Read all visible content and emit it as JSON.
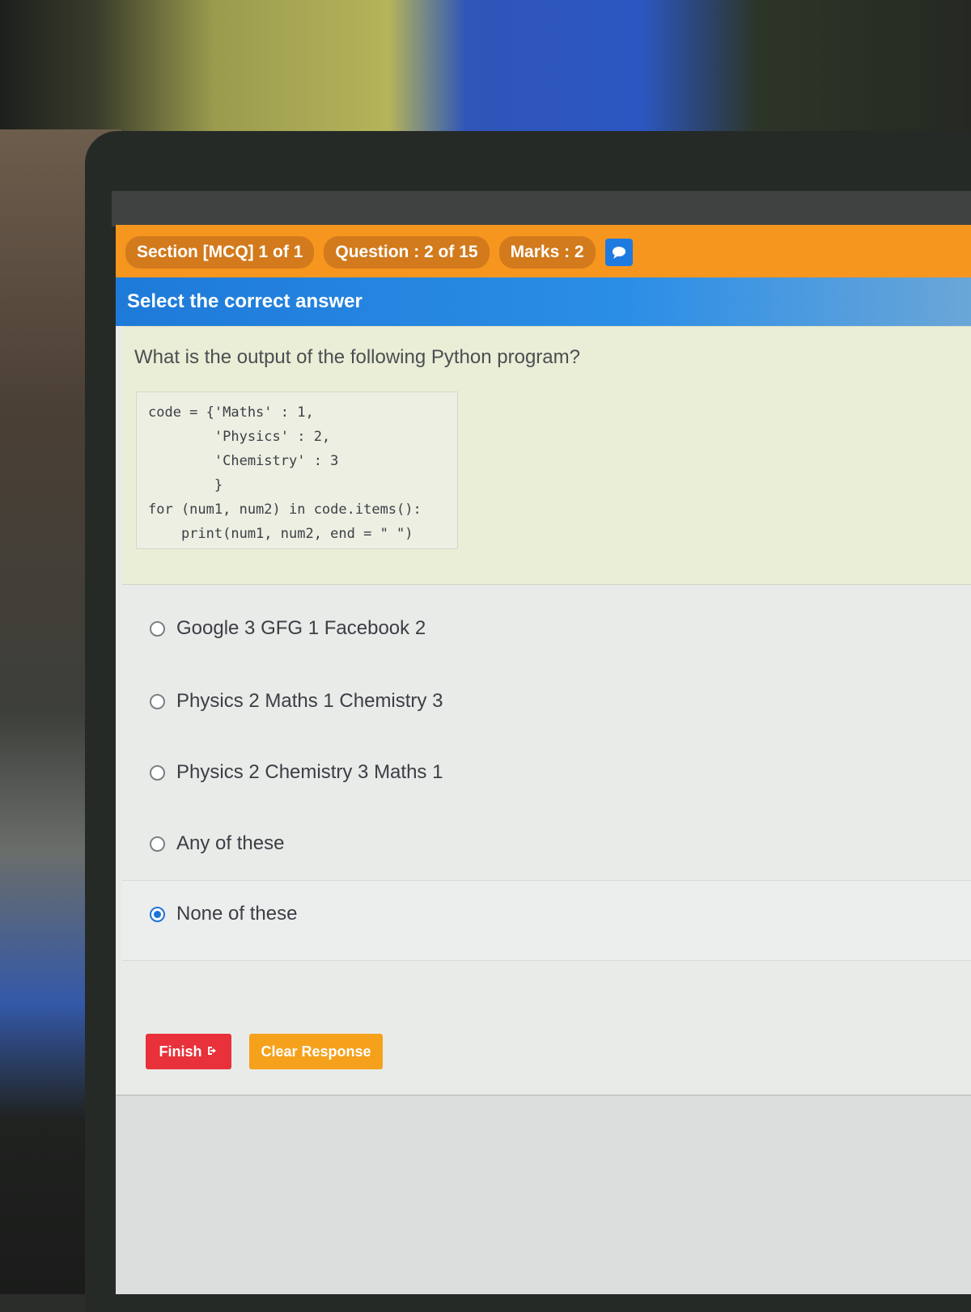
{
  "header": {
    "section_label": "Section [MCQ] 1 of 1",
    "question_label": "Question : 2 of 15",
    "marks_label": "Marks : 2",
    "chat_icon": "chat-icon"
  },
  "instruction": "Select the correct answer",
  "question": {
    "text": "What is the output of the following Python program?",
    "code_lines": [
      "code = {'Maths' : 1,",
      "        'Physics' : 2,",
      "        'Chemistry' : 3",
      "        }",
      "for (num1, num2) in code.items():",
      "    print(num1, num2, end = \" \")"
    ]
  },
  "options": [
    {
      "label": "Google 3 GFG 1 Facebook 2",
      "selected": false
    },
    {
      "label": "Physics 2 Maths 1 Chemistry 3",
      "selected": false
    },
    {
      "label": "Physics 2 Chemistry 3 Maths 1",
      "selected": false
    },
    {
      "label": "Any of these",
      "selected": false
    },
    {
      "label": "None of these",
      "selected": true
    }
  ],
  "buttons": {
    "finish": "Finish",
    "finish_icon": "sign-out-icon",
    "clear": "Clear Response"
  },
  "colors": {
    "header_orange": "#f6961e",
    "instruction_blue": "#1e7ad8",
    "finish_red": "#e8313a",
    "clear_orange": "#f5a11c",
    "selected_blue": "#1e73d6"
  }
}
